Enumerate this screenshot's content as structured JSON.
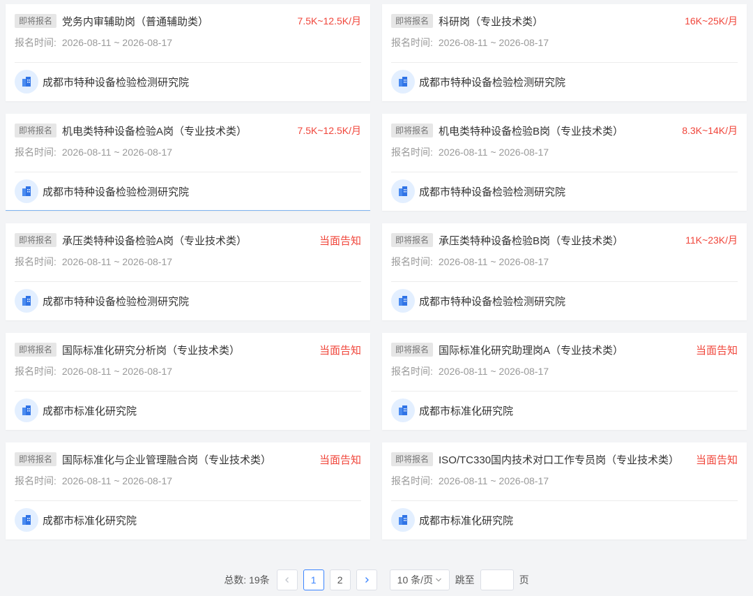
{
  "colors": {
    "accent": "#3a84ff",
    "salary": "#f0453a",
    "badge_bg": "#e6e6e6"
  },
  "jobs": [
    {
      "badge": "即将报名",
      "title": "党务内审辅助岗（普通辅助类）",
      "salary": "7.5K~12.5K/月",
      "time_label": "报名时间:",
      "time_value": "2026-08-11 ~ 2026-08-17",
      "org": "成都市特种设备检验检测研究院",
      "org_icon": "building-icon"
    },
    {
      "badge": "即将报名",
      "title": "科研岗（专业技术类）",
      "salary": "16K~25K/月",
      "time_label": "报名时间:",
      "time_value": "2026-08-11 ~ 2026-08-17",
      "org": "成都市特种设备检验检测研究院",
      "org_icon": "building-icon"
    },
    {
      "badge": "即将报名",
      "title": "机电类特种设备检验A岗（专业技术类）",
      "salary": "7.5K~12.5K/月",
      "time_label": "报名时间:",
      "time_value": "2026-08-11 ~ 2026-08-17",
      "org": "成都市特种设备检验检测研究院",
      "org_icon": "building-icon"
    },
    {
      "badge": "即将报名",
      "title": "机电类特种设备检验B岗（专业技术类）",
      "salary": "8.3K~14K/月",
      "time_label": "报名时间:",
      "time_value": "2026-08-11 ~ 2026-08-17",
      "org": "成都市特种设备检验检测研究院",
      "org_icon": "building-icon"
    },
    {
      "badge": "即将报名",
      "title": "承压类特种设备检验A岗（专业技术类）",
      "salary": "当面告知",
      "time_label": "报名时间:",
      "time_value": "2026-08-11 ~ 2026-08-17",
      "org": "成都市特种设备检验检测研究院",
      "org_icon": "building-icon"
    },
    {
      "badge": "即将报名",
      "title": "承压类特种设备检验B岗（专业技术类）",
      "salary": "11K~23K/月",
      "time_label": "报名时间:",
      "time_value": "2026-08-11 ~ 2026-08-17",
      "org": "成都市特种设备检验检测研究院",
      "org_icon": "building-icon"
    },
    {
      "badge": "即将报名",
      "title": "国际标准化研究分析岗（专业技术类）",
      "salary": "当面告知",
      "time_label": "报名时间:",
      "time_value": "2026-08-11 ~ 2026-08-17",
      "org": "成都市标准化研究院",
      "org_icon": "building-icon"
    },
    {
      "badge": "即将报名",
      "title": "国际标准化研究助理岗A（专业技术类）",
      "salary": "当面告知",
      "time_label": "报名时间:",
      "time_value": "2026-08-11 ~ 2026-08-17",
      "org": "成都市标准化研究院",
      "org_icon": "building-icon"
    },
    {
      "badge": "即将报名",
      "title": "国际标准化与企业管理融合岗（专业技术类）",
      "salary": "当面告知",
      "time_label": "报名时间:",
      "time_value": "2026-08-11 ~ 2026-08-17",
      "org": "成都市标准化研究院",
      "org_icon": "building-icon"
    },
    {
      "badge": "即将报名",
      "title": "ISO/TC330国内技术对口工作专员岗（专业技术类）",
      "salary": "当面告知",
      "time_label": "报名时间:",
      "time_value": "2026-08-11 ~ 2026-08-17",
      "org": "成都市标准化研究院",
      "org_icon": "building-icon"
    }
  ],
  "pagination": {
    "total_label": "总数: 19条",
    "prev_icon": "chevron-left-icon",
    "next_icon": "chevron-right-icon",
    "pages": [
      "1",
      "2"
    ],
    "current_page": "1",
    "page_size": "10 条/页",
    "jump_label": "跳至",
    "jump_value": "",
    "page_suffix": "页"
  }
}
